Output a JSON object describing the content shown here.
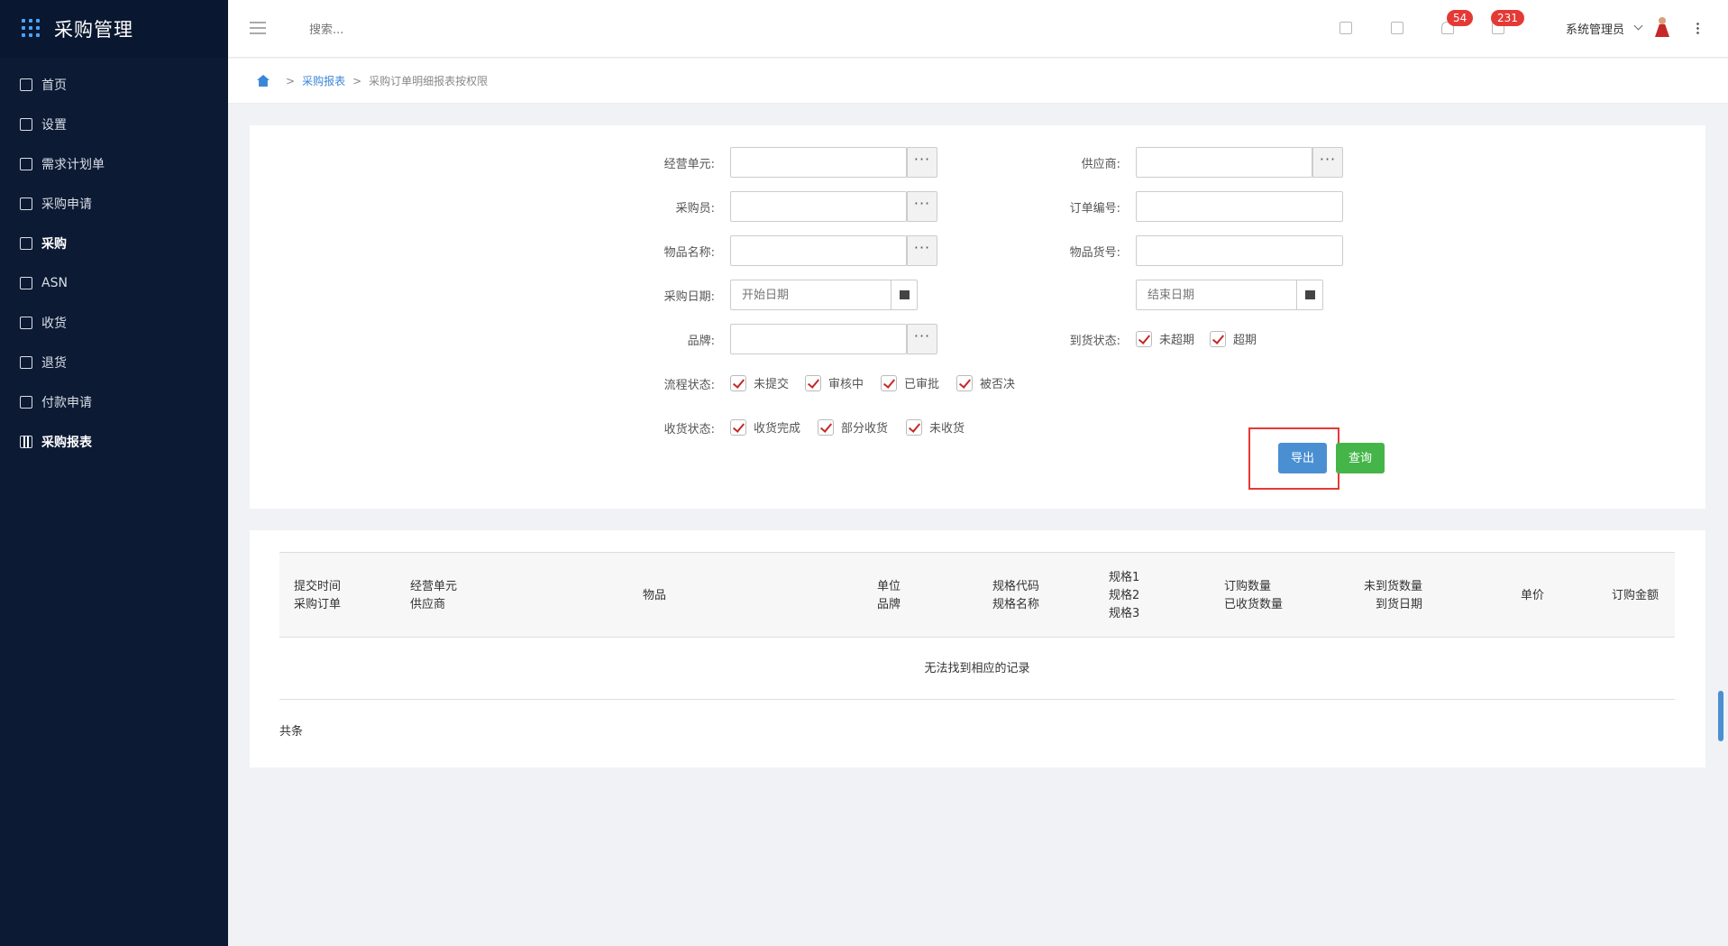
{
  "app": {
    "title": "采购管理"
  },
  "sidebar": {
    "items": [
      {
        "label": "首页",
        "icon": "home-icon"
      },
      {
        "label": "设置",
        "icon": "gear-icon"
      },
      {
        "label": "需求计划单",
        "icon": "document-icon"
      },
      {
        "label": "采购申请",
        "icon": "clipboard-icon"
      },
      {
        "label": "采购",
        "icon": "list-icon"
      },
      {
        "label": "ASN",
        "icon": "truck-icon"
      },
      {
        "label": "收货",
        "icon": "inbox-icon"
      },
      {
        "label": "退货",
        "icon": "return-icon"
      },
      {
        "label": "付款申请",
        "icon": "payment-icon"
      },
      {
        "label": "采购报表",
        "icon": "bar-chart-icon"
      }
    ]
  },
  "header": {
    "search_placeholder": "搜索...",
    "notifications_count": "54",
    "messages_count": "231",
    "user_name": "系统管理员"
  },
  "breadcrumb": {
    "parent": "采购报表",
    "current": "采购订单明细报表按权限",
    "separator": ">"
  },
  "filters": {
    "business_unit_label": "经营单元:",
    "supplier_label": "供应商:",
    "buyer_label": "采购员:",
    "order_no_label": "订单编号:",
    "item_name_label": "物品名称:",
    "item_code_label": "物品货号:",
    "purchase_date_label": "采购日期:",
    "start_date_placeholder": "开始日期",
    "end_date_placeholder": "结束日期",
    "brand_label": "品牌:",
    "arrival_status_label": "到货状态:",
    "arrival_options": [
      "未超期",
      "超期"
    ],
    "flow_status_label": "流程状态:",
    "flow_options": [
      "未提交",
      "审核中",
      "已审批",
      "被否决"
    ],
    "receipt_status_label": "收货状态:",
    "receipt_options": [
      "收货完成",
      "部分收货",
      "未收货"
    ],
    "lookup_glyph": "···"
  },
  "actions": {
    "export_label": "导出",
    "query_label": "查询"
  },
  "table": {
    "columns": [
      [
        "提交时间",
        "采购订单"
      ],
      [
        "经营单元",
        "供应商"
      ],
      [
        "物品"
      ],
      [
        "单位",
        "品牌"
      ],
      [
        "规格代码",
        "规格名称"
      ],
      [
        "规格1",
        "规格2",
        "规格3"
      ],
      [
        "订购数量",
        "已收货数量"
      ],
      [
        "未到货数量",
        "到货日期"
      ],
      [
        "单价"
      ],
      [
        "订购金额"
      ]
    ],
    "empty_text": "无法找到相应的记录",
    "total_text": "共条"
  },
  "colors": {
    "sidebar_bg": "#0c1a33",
    "accent_blue": "#4a8fd1",
    "query_green": "#45b549",
    "badge_red": "#e53935"
  }
}
